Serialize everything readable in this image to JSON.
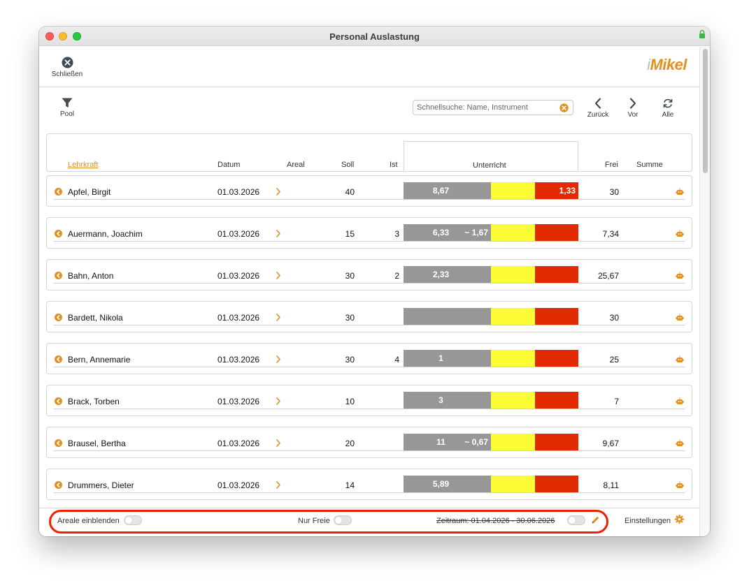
{
  "window": {
    "title": "Personal Auslastung"
  },
  "toolbar": {
    "close_label": "Schließen",
    "logo_prefix": "i",
    "logo_text": "Mikel"
  },
  "filterbar": {
    "pool_label": "Pool",
    "search_placeholder": "Schnellsuche: Name, Instrument",
    "back_label": "Zurück",
    "forward_label": "Vor",
    "all_label": "Alle"
  },
  "columns": {
    "lehrkraft": "Lehrkraft",
    "datum": "Datum",
    "areal": "Areal",
    "soll": "Soll",
    "ist": "Ist",
    "unterricht": "Unterricht",
    "frei": "Frei",
    "summe": "Summe"
  },
  "rows": [
    {
      "name": "Apfel, Birgit",
      "date": "01.03.2026",
      "soll": "40",
      "ist": "",
      "grey": "8,67",
      "approx": "",
      "red": "1,33",
      "frei": "30"
    },
    {
      "name": "Auermann, Joachim",
      "date": "01.03.2026",
      "soll": "15",
      "ist": "3",
      "grey": "6,33",
      "approx": "~ 1,67",
      "red": "",
      "frei": "7,34"
    },
    {
      "name": "Bahn, Anton",
      "date": "01.03.2026",
      "soll": "30",
      "ist": "2",
      "grey": "2,33",
      "approx": "",
      "red": "",
      "frei": "25,67"
    },
    {
      "name": "Bardett, Nikola",
      "date": "01.03.2026",
      "soll": "30",
      "ist": "",
      "grey": "",
      "approx": "",
      "red": "",
      "frei": "30"
    },
    {
      "name": "Bern, Annemarie",
      "date": "01.03.2026",
      "soll": "30",
      "ist": "4",
      "grey": "1",
      "approx": "",
      "red": "",
      "frei": "25"
    },
    {
      "name": "Brack, Torben",
      "date": "01.03.2026",
      "soll": "10",
      "ist": "",
      "grey": "3",
      "approx": "",
      "red": "",
      "frei": "7"
    },
    {
      "name": "Brausel, Bertha",
      "date": "01.03.2026",
      "soll": "20",
      "ist": "",
      "grey": "11",
      "approx": "~ 0,67",
      "red": "",
      "frei": "9,67"
    },
    {
      "name": "Drummers, Dieter",
      "date": "01.03.2026",
      "soll": "14",
      "ist": "",
      "grey": "5,89",
      "approx": "",
      "red": "",
      "frei": "8,11"
    }
  ],
  "footer": {
    "areale_label": "Areale einblenden",
    "nur_freie_label": "Nur Freie",
    "zeitraum_label": "Zeitraum: 01.04.2026 - 30.06.2026",
    "settings_label": "Einstellungen"
  },
  "colors": {
    "accent": "#e3901f",
    "grey_bar": "#979797",
    "yellow_bar": "#fcfd35",
    "red_bar": "#e12a00",
    "highlight": "#f01d00"
  }
}
